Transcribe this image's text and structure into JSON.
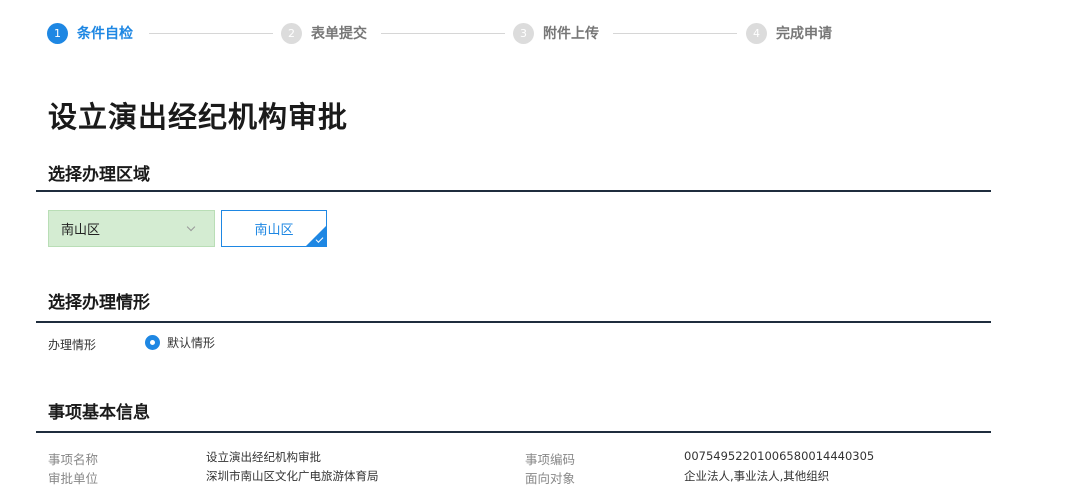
{
  "steps": [
    {
      "num": "1",
      "label": "条件自检"
    },
    {
      "num": "2",
      "label": "表单提交"
    },
    {
      "num": "3",
      "label": "附件上传"
    },
    {
      "num": "4",
      "label": "完成申请"
    }
  ],
  "page_title": "设立演出经纪机构审批",
  "region_section": {
    "title": "选择办理区域",
    "selected": "南山区",
    "tag": "南山区"
  },
  "situation_section": {
    "title": "选择办理情形",
    "label": "办理情形",
    "option": "默认情形"
  },
  "info_section": {
    "title": "事项基本信息",
    "name_key": "事项名称",
    "name_val": "设立演出经纪机构审批",
    "dept_key": "审批单位",
    "dept_val": "深圳市南山区文化广电旅游体育局",
    "code_key": "事项编码",
    "code_val": "00754952201006580014440305",
    "target_key": "面向对象",
    "target_val": "企业法人,事业法人,其他组织"
  },
  "colors": {
    "accent": "#1e87e3",
    "select_bg": "#d4ecd2",
    "rule": "#1f2d3d"
  }
}
